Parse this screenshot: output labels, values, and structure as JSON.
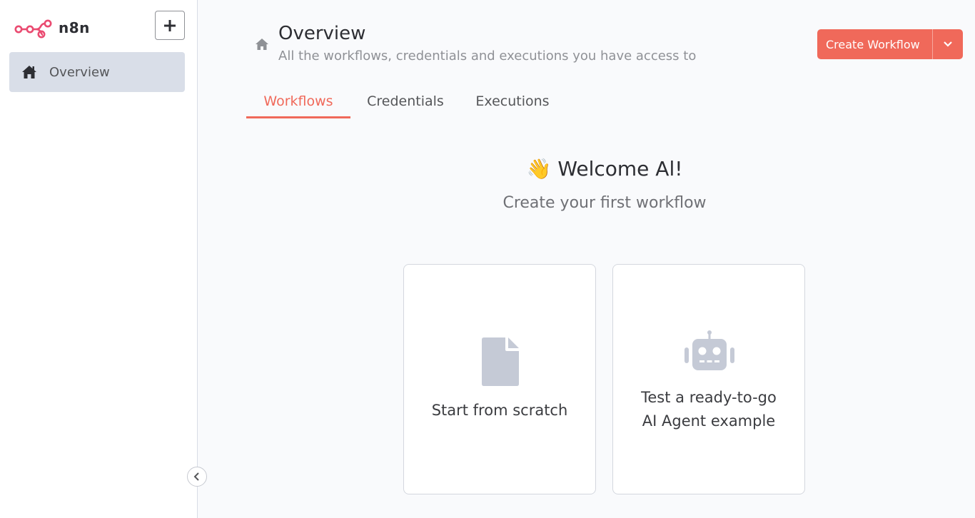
{
  "sidebar": {
    "brand": "n8n",
    "items": [
      {
        "label": "Overview",
        "icon": "home-icon"
      }
    ]
  },
  "header": {
    "title": "Overview",
    "subtitle": "All the workflows, credentials and executions you have access to",
    "create_label": "Create Workflow"
  },
  "tabs": [
    {
      "label": "Workflows",
      "active": true
    },
    {
      "label": "Credentials",
      "active": false
    },
    {
      "label": "Executions",
      "active": false
    }
  ],
  "welcome": {
    "emoji": "👋",
    "title": "Welcome Al!",
    "subtitle": "Create your first workflow"
  },
  "cards": [
    {
      "label": "Start from scratch",
      "icon": "file-icon"
    },
    {
      "line1": "Test a ready-to-go",
      "line2": "AI Agent example",
      "icon": "robot-icon"
    }
  ],
  "colors": {
    "accent": "#f0695a",
    "nav_active_bg": "#d9dee8",
    "icon_gray": "#c5cad6"
  }
}
